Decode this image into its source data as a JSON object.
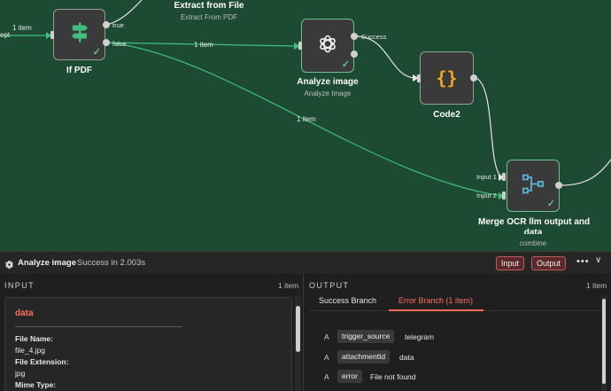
{
  "canvas": {
    "nodes": {
      "if_pdf": {
        "title": "If PDF",
        "port_true": "true",
        "port_false": "false"
      },
      "extract": {
        "title": "Extract from File",
        "subtitle": "Extract From PDF"
      },
      "analyze": {
        "title": "Analyze image",
        "subtitle": "Analyze Image",
        "port_success": "Success"
      },
      "code2": {
        "title": "Code2"
      },
      "merge": {
        "title_line1": "Merge OCR llm output and",
        "title_line2": "data",
        "subtitle": "combine",
        "input1": "Input 1",
        "input2": "Input 2"
      }
    },
    "edge_labels": {
      "incoming": "1 item",
      "incoming_port": "ept",
      "false_to_analyze": "1 item",
      "false_to_merge": "1 item"
    }
  },
  "header": {
    "title": "Analyze image",
    "status": "Success in 2.003s",
    "input_button": "Input",
    "output_button": "Output",
    "more": "•••",
    "chevron": "∨"
  },
  "input_panel": {
    "title": "INPUT",
    "count": "1 item",
    "card_title": "data",
    "fields": [
      {
        "text": "File Name:",
        "bold": true
      },
      {
        "text": "file_4.jpg",
        "bold": false
      },
      {
        "text": "File Extension:",
        "bold": true
      },
      {
        "text": "jpg",
        "bold": false
      },
      {
        "text": "Mime Type:",
        "bold": true
      }
    ]
  },
  "output_panel": {
    "title": "OUTPUT",
    "count": "1 item",
    "tabs": [
      "Success Branch",
      "Error Branch (1 item)"
    ],
    "active_tab": 1,
    "rows": [
      {
        "type": "A",
        "key": "trigger_source",
        "value": "telegram"
      },
      {
        "type": "A",
        "key": "attachmentId",
        "value": "data"
      },
      {
        "type": "A",
        "key": "error",
        "value": "File not found"
      }
    ]
  },
  "colors": {
    "canvas_bg": "#1d4a33",
    "accent": "#ff6d5a",
    "edge": "#3fbf7a",
    "node_ok": "#6ac48c"
  },
  "icons": [
    "openai-icon",
    "braces-icon",
    "signpost-icon",
    "merge-icon",
    "check-icon",
    "more-icon",
    "chevron-down-icon"
  ]
}
